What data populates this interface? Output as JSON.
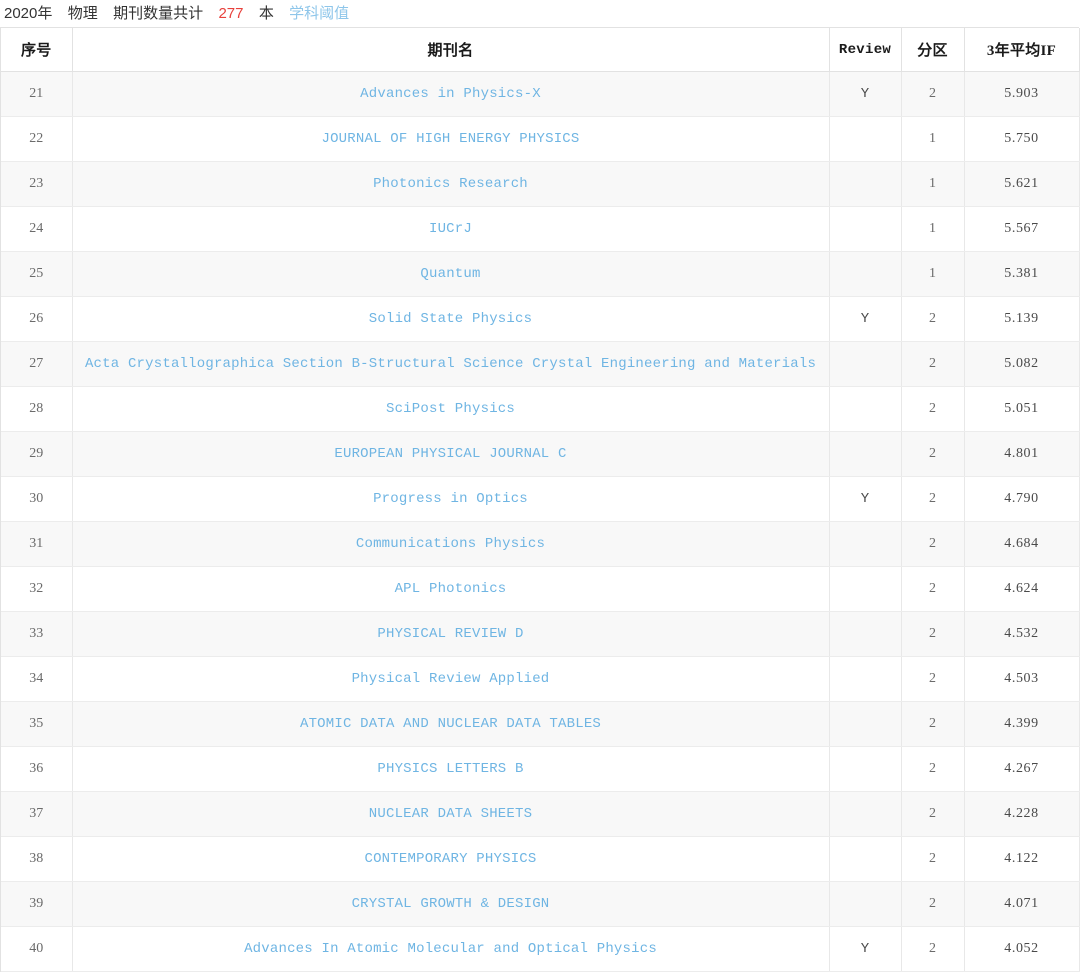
{
  "caption": {
    "year": "2020年",
    "subject": "物理",
    "count_label": "期刊数量共计",
    "count": "277",
    "unit": "本",
    "threshold_link": "学科阈值",
    "count_color": "#e8413c",
    "link_color": "#8ec6ea"
  },
  "table": {
    "columns": [
      {
        "key": "no",
        "label": "序号",
        "script": "cjk"
      },
      {
        "key": "name",
        "label": "期刊名",
        "script": "cjk"
      },
      {
        "key": "review",
        "label": "Review",
        "script": "latin"
      },
      {
        "key": "zone",
        "label": "分区",
        "script": "cjk"
      },
      {
        "key": "if3",
        "label": "3年平均IF",
        "script": "cjk"
      }
    ],
    "rows": [
      {
        "no": "21",
        "name": "Advances in Physics-X",
        "review": "Y",
        "zone": "2",
        "if3": "5.903"
      },
      {
        "no": "22",
        "name": "JOURNAL OF HIGH ENERGY PHYSICS",
        "review": "",
        "zone": "1",
        "if3": "5.750"
      },
      {
        "no": "23",
        "name": "Photonics Research",
        "review": "",
        "zone": "1",
        "if3": "5.621"
      },
      {
        "no": "24",
        "name": "IUCrJ",
        "review": "",
        "zone": "1",
        "if3": "5.567"
      },
      {
        "no": "25",
        "name": "Quantum",
        "review": "",
        "zone": "1",
        "if3": "5.381"
      },
      {
        "no": "26",
        "name": "Solid State Physics",
        "review": "Y",
        "zone": "2",
        "if3": "5.139"
      },
      {
        "no": "27",
        "name": "Acta Crystallographica Section B-Structural Science Crystal Engineering and Materials",
        "review": "",
        "zone": "2",
        "if3": "5.082"
      },
      {
        "no": "28",
        "name": "SciPost Physics",
        "review": "",
        "zone": "2",
        "if3": "5.051"
      },
      {
        "no": "29",
        "name": "EUROPEAN PHYSICAL JOURNAL C",
        "review": "",
        "zone": "2",
        "if3": "4.801"
      },
      {
        "no": "30",
        "name": "Progress in Optics",
        "review": "Y",
        "zone": "2",
        "if3": "4.790"
      },
      {
        "no": "31",
        "name": "Communications Physics",
        "review": "",
        "zone": "2",
        "if3": "4.684"
      },
      {
        "no": "32",
        "name": "APL Photonics",
        "review": "",
        "zone": "2",
        "if3": "4.624"
      },
      {
        "no": "33",
        "name": "PHYSICAL REVIEW D",
        "review": "",
        "zone": "2",
        "if3": "4.532"
      },
      {
        "no": "34",
        "name": "Physical Review Applied",
        "review": "",
        "zone": "2",
        "if3": "4.503"
      },
      {
        "no": "35",
        "name": "ATOMIC DATA AND NUCLEAR DATA TABLES",
        "review": "",
        "zone": "2",
        "if3": "4.399"
      },
      {
        "no": "36",
        "name": "PHYSICS LETTERS B",
        "review": "",
        "zone": "2",
        "if3": "4.267"
      },
      {
        "no": "37",
        "name": "NUCLEAR DATA SHEETS",
        "review": "",
        "zone": "2",
        "if3": "4.228"
      },
      {
        "no": "38",
        "name": "CONTEMPORARY PHYSICS",
        "review": "",
        "zone": "2",
        "if3": "4.122"
      },
      {
        "no": "39",
        "name": "CRYSTAL GROWTH & DESIGN",
        "review": "",
        "zone": "2",
        "if3": "4.071"
      },
      {
        "no": "40",
        "name": "Advances In Atomic Molecular and Optical Physics",
        "review": "Y",
        "zone": "2",
        "if3": "4.052"
      }
    ]
  }
}
